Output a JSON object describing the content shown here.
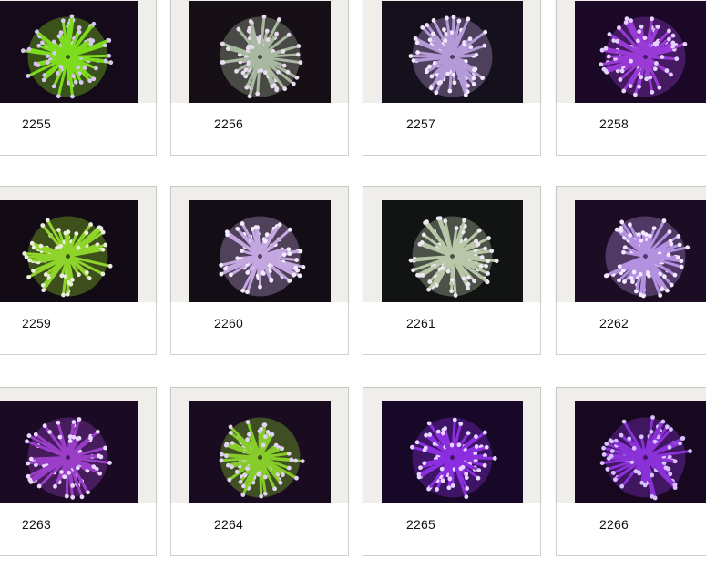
{
  "gallery": {
    "items": [
      {
        "id": "2255",
        "label": "2255",
        "body": "#7ddc1e",
        "tip": "#d9c6f2",
        "bg": "#140a1a"
      },
      {
        "id": "2256",
        "label": "2256",
        "body": "#a9b8a0",
        "tip": "#e9dcf0",
        "bg": "#161016"
      },
      {
        "id": "2257",
        "label": "2257",
        "body": "#b59ad8",
        "tip": "#f1e6fb",
        "bg": "#14101c"
      },
      {
        "id": "2258",
        "label": "2258",
        "body": "#9a3ad6",
        "tip": "#e6d2ff",
        "bg": "#1a0826"
      },
      {
        "id": "2259",
        "label": "2259",
        "body": "#8fd42a",
        "tip": "#e9eedd",
        "bg": "#120a14"
      },
      {
        "id": "2260",
        "label": "2260",
        "body": "#c4a6e0",
        "tip": "#f3eafb",
        "bg": "#130d15"
      },
      {
        "id": "2261",
        "label": "2261",
        "body": "#b9c7a8",
        "tip": "#eee8f2",
        "bg": "#121414"
      },
      {
        "id": "2262",
        "label": "2262",
        "body": "#b390e0",
        "tip": "#f2e8ff",
        "bg": "#1c0d24"
      },
      {
        "id": "2263",
        "label": "2263",
        "body": "#9a3ec8",
        "tip": "#ead8ff",
        "bg": "#1a0a24"
      },
      {
        "id": "2264",
        "label": "2264",
        "body": "#86cc2a",
        "tip": "#e2d2f6",
        "bg": "#1a0c20"
      },
      {
        "id": "2265",
        "label": "2265",
        "body": "#8a2ee0",
        "tip": "#e8d6ff",
        "bg": "#160826"
      },
      {
        "id": "2266",
        "label": "2266",
        "body": "#8a32d8",
        "tip": "#d9c0ff",
        "bg": "#17081f"
      }
    ]
  }
}
